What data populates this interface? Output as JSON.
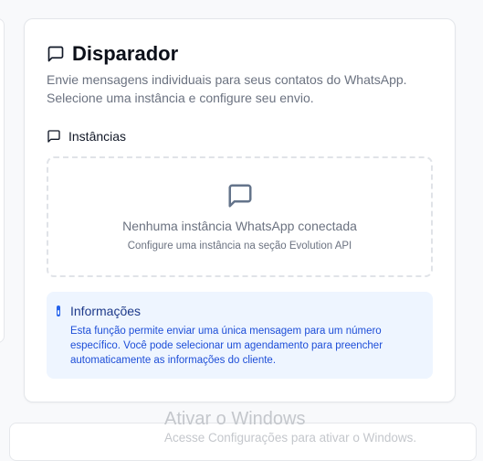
{
  "card": {
    "title": "Disparador",
    "title_icon": "message-square-icon",
    "description": "Envie mensagens individuais para seus contatos do WhatsApp. Selecione uma instância e configure seu envio."
  },
  "instances": {
    "label": "Instâncias",
    "icon": "message-square-icon",
    "empty_title": "Nenhuma instância WhatsApp conectada",
    "empty_subtitle": "Configure uma instância na seção Evolution API"
  },
  "info": {
    "icon": "info-icon",
    "title": "Informações",
    "text": "Esta função permite enviar uma única mensagem para um número específico. Você pode selecionar um agendamento para preencher automaticamente as informações do cliente."
  },
  "watermark": {
    "title": "Ativar o Windows",
    "subtitle": "Acesse Configurações para ativar o Windows."
  },
  "colors": {
    "accent": "#2563eb",
    "info_bg": "#eef5ff",
    "muted_text": "#6b7280"
  }
}
